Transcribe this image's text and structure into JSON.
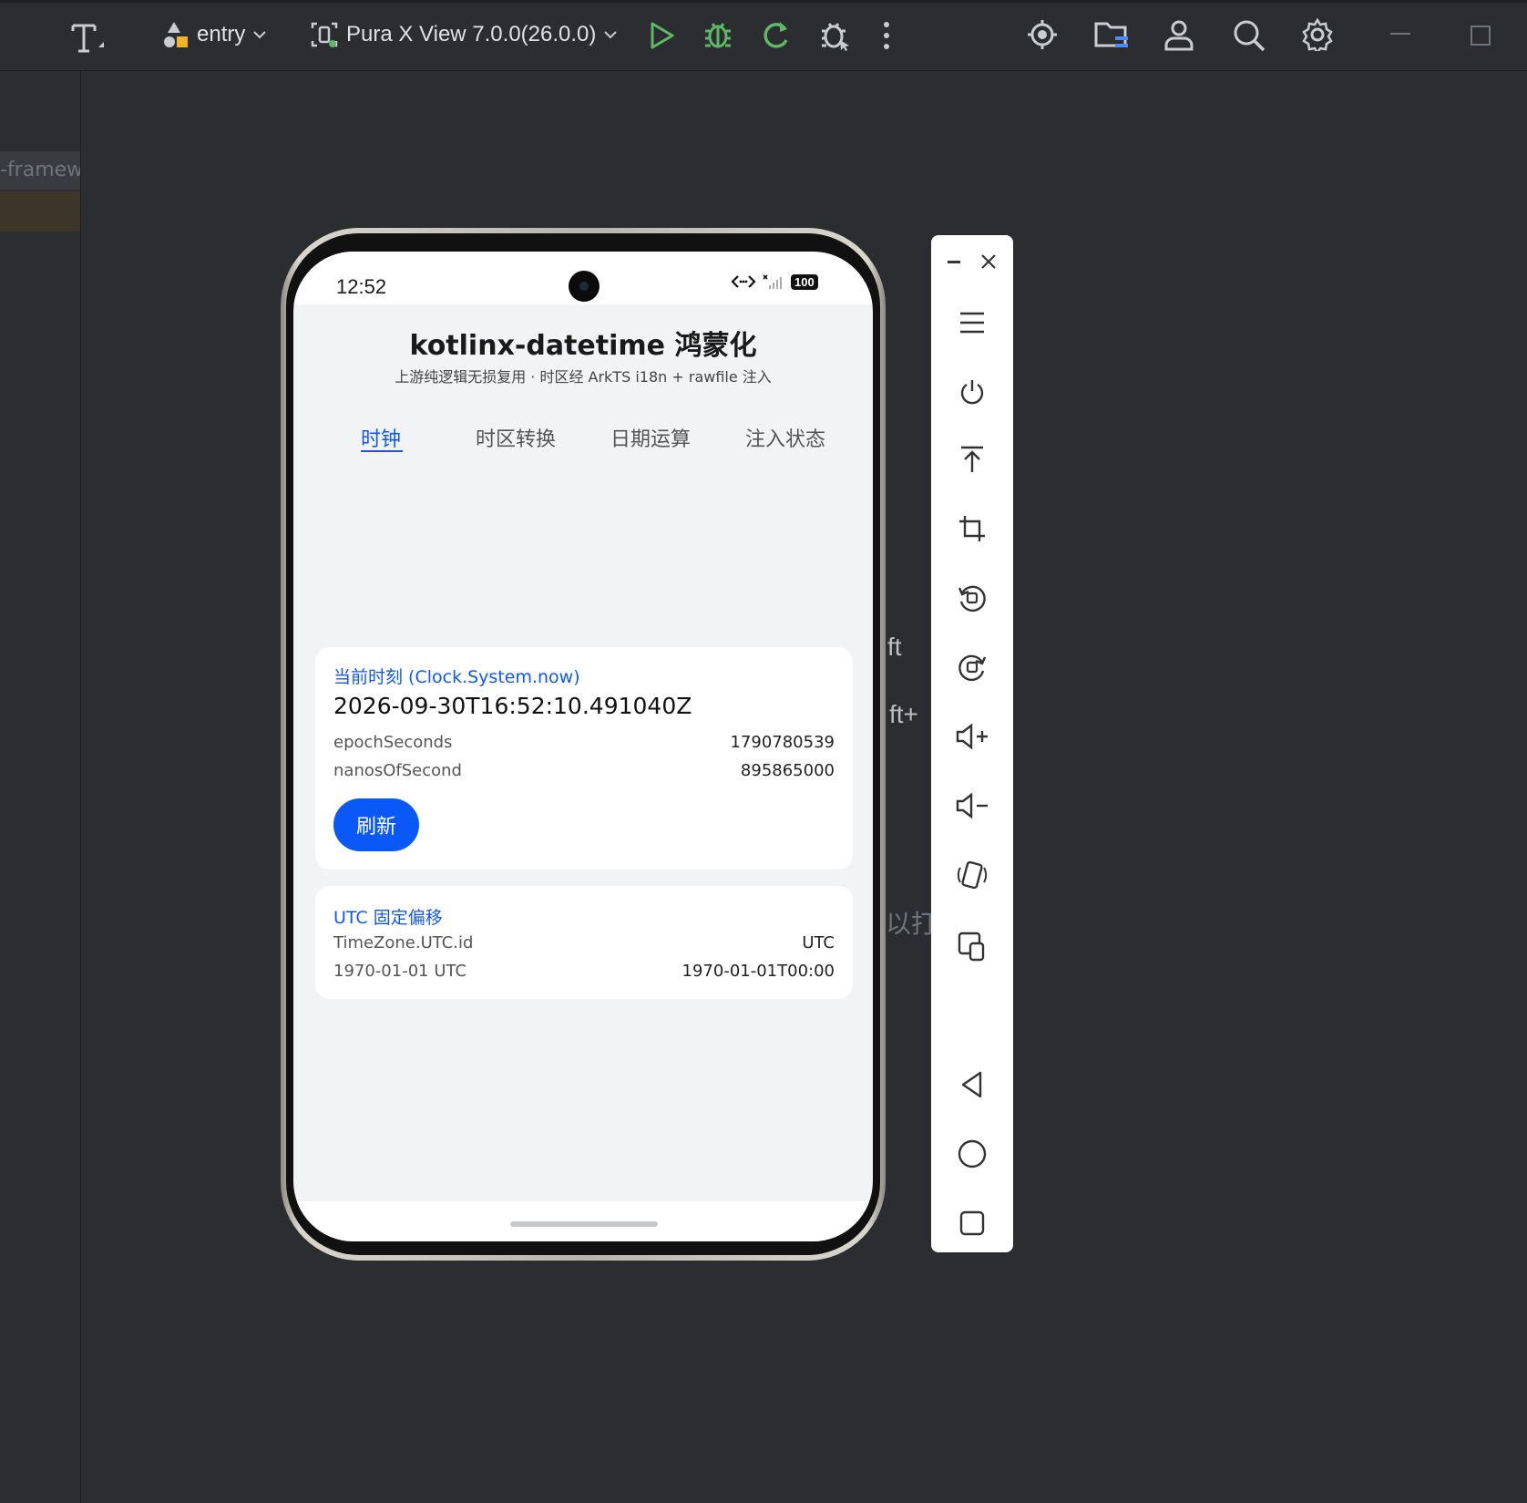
{
  "toolbar": {
    "run_config": "entry",
    "device": "Pura X View 7.0.0(26.0.0)"
  },
  "left_panel": {
    "item_label": "-framew"
  },
  "behind_text": {
    "line1": "ft",
    "line2": "ft+",
    "line3": "以打"
  },
  "phone": {
    "status": {
      "time": "12:52",
      "battery": "100"
    },
    "app": {
      "title": "kotlinx-datetime 鸿蒙化",
      "subtitle": "上游纯逻辑无损复用 · 时区经 ArkTS i18n + rawfile 注入"
    },
    "tabs": [
      {
        "label": "时钟",
        "active": true
      },
      {
        "label": "时区转换",
        "active": false
      },
      {
        "label": "日期运算",
        "active": false
      },
      {
        "label": "注入状态",
        "active": false
      }
    ],
    "clock_card": {
      "title": "当前时刻 (Clock.System.now)",
      "instant": "2026-09-30T16:52:10.491040Z",
      "rows": [
        {
          "label": "epochSeconds",
          "value": "1790780539"
        },
        {
          "label": "nanosOfSecond",
          "value": "895865000"
        }
      ],
      "refresh_label": "刷新"
    },
    "utc_card": {
      "title": "UTC 固定偏移",
      "rows": [
        {
          "label": "TimeZone.UTC.id",
          "value": "UTC"
        },
        {
          "label": "1970-01-01 UTC",
          "value": "1970-01-01T00:00"
        }
      ]
    }
  },
  "colors": {
    "accent": "#1458e8",
    "button": "#0a59f7",
    "ide_bg": "#2b2d30",
    "run_green": "#5fb865"
  }
}
